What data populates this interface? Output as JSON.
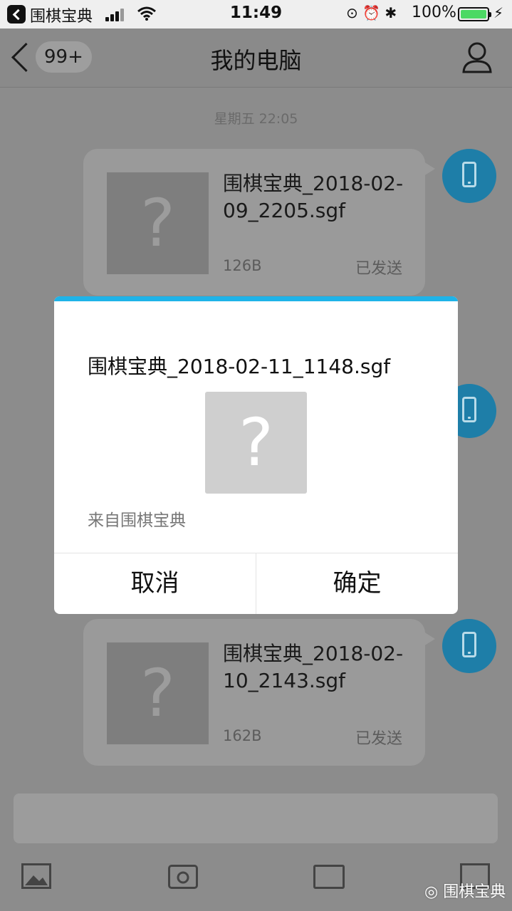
{
  "status_bar": {
    "app_name": "围棋宝典",
    "time": "11:49",
    "battery_percent": "100%",
    "battery_level": 1.0
  },
  "nav": {
    "badge": "99+",
    "title": "我的电脑"
  },
  "chat": {
    "timestamp": "星期五 22:05",
    "messages": [
      {
        "filename": "围棋宝典_2018-02-09_2205.sgf",
        "size": "126B",
        "status": "已发送"
      },
      {
        "filename": "围棋宝典_2018-02-10_2143.sgf",
        "size": "162B",
        "status": "已发送"
      }
    ]
  },
  "dialog": {
    "filename": "围棋宝典_2018-02-11_1148.sgf",
    "placeholder_glyph": "?",
    "from": "来自围棋宝典",
    "cancel": "取消",
    "confirm": "确定"
  },
  "watermark": "围棋宝典",
  "colors": {
    "accent": "#1fb3e8",
    "avatar": "#1e7ea8",
    "battery": "#4cd964"
  }
}
